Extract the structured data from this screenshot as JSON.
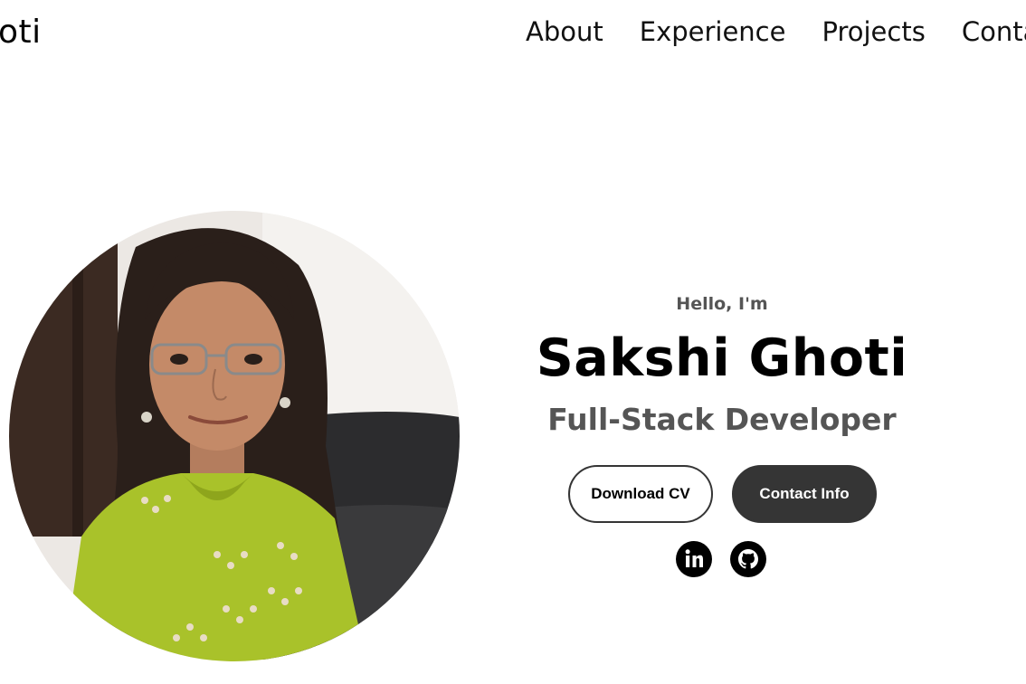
{
  "header": {
    "logo_text": "oti",
    "nav": [
      {
        "label": "About"
      },
      {
        "label": "Experience"
      },
      {
        "label": "Projects"
      },
      {
        "label": "Contact"
      }
    ]
  },
  "hero": {
    "greeting": "Hello, I'm",
    "name": "Sakshi Ghoti",
    "role": "Full-Stack Developer",
    "buttons": {
      "download_cv": "Download CV",
      "contact_info": "Contact Info"
    },
    "socials": [
      {
        "icon": "linkedin-icon"
      },
      {
        "icon": "github-icon"
      }
    ]
  },
  "colors": {
    "text_dark": "#000000",
    "text_muted": "#555555",
    "button_dark": "#353535",
    "background": "#ffffff"
  }
}
